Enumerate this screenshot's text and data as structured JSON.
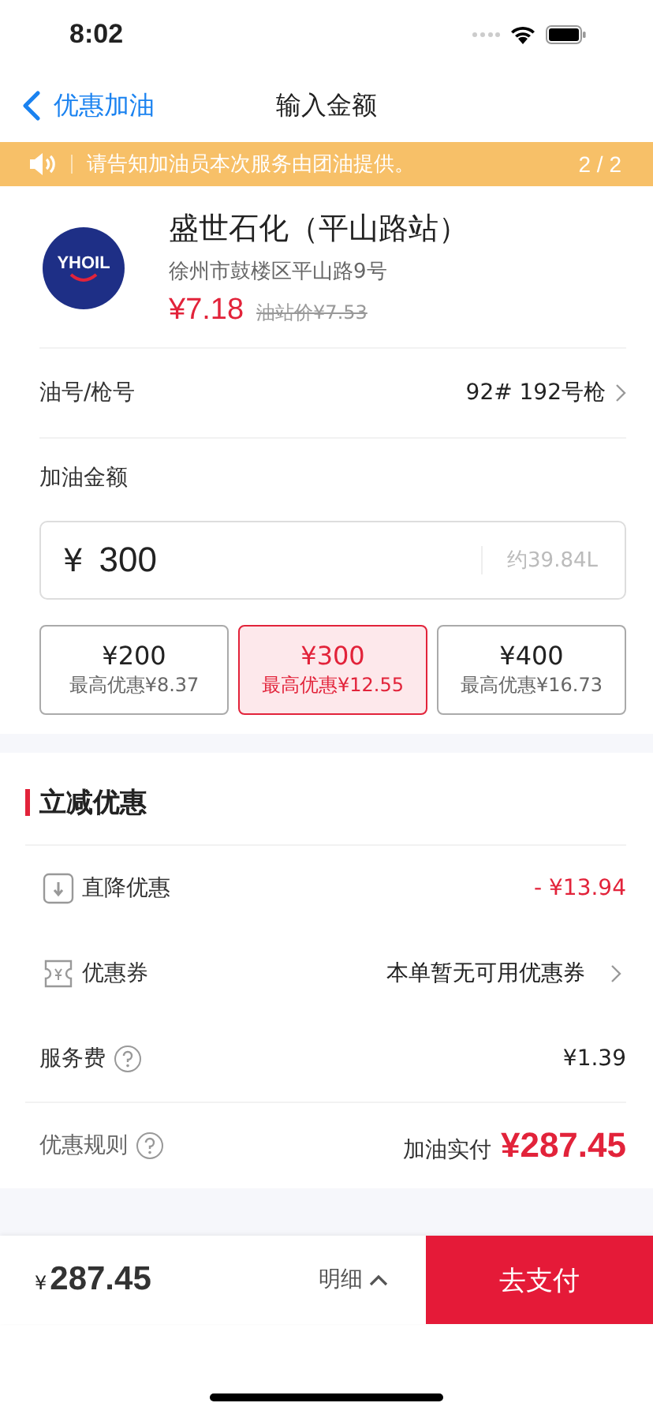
{
  "status_bar": {
    "time": "8:02"
  },
  "nav": {
    "back_label": "优惠加油",
    "title": "输入金额"
  },
  "notice": {
    "text": "请告知加油员本次服务由团油提供。",
    "pager": "2 / 2"
  },
  "station": {
    "name": "盛世石化（平山路站）",
    "address": "徐州市鼓楼区平山路9号",
    "price": "¥7.18",
    "list_price": "油站价¥7.53",
    "logo_text": "YHOIL"
  },
  "fuel": {
    "label": "油号/枪号",
    "value": "92# 192号枪"
  },
  "amount": {
    "label": "加油金额",
    "currency": "¥",
    "value": "300",
    "liters": "约39.84L"
  },
  "options": [
    {
      "amount": "¥200",
      "discount": "最高优惠¥8.37",
      "selected": false
    },
    {
      "amount": "¥300",
      "discount": "最高优惠¥12.55",
      "selected": true
    },
    {
      "amount": "¥400",
      "discount": "最高优惠¥16.73",
      "selected": false
    }
  ],
  "discount_section": {
    "title": "立减优惠"
  },
  "rows": [
    {
      "kind": "direct",
      "label": "直降优惠",
      "value": "- ¥13.94"
    },
    {
      "kind": "coupon",
      "label": "优惠券",
      "value": "本单暂无可用优惠券"
    },
    {
      "kind": "fee",
      "label": "服务费",
      "value": "¥1.39"
    },
    {
      "kind": "rule",
      "label": "优惠规则",
      "value_label": "加油实付",
      "value": "¥287.45"
    }
  ],
  "footer": {
    "currency": "¥",
    "total": "287.45",
    "details": "明细",
    "pay": "去支付"
  }
}
